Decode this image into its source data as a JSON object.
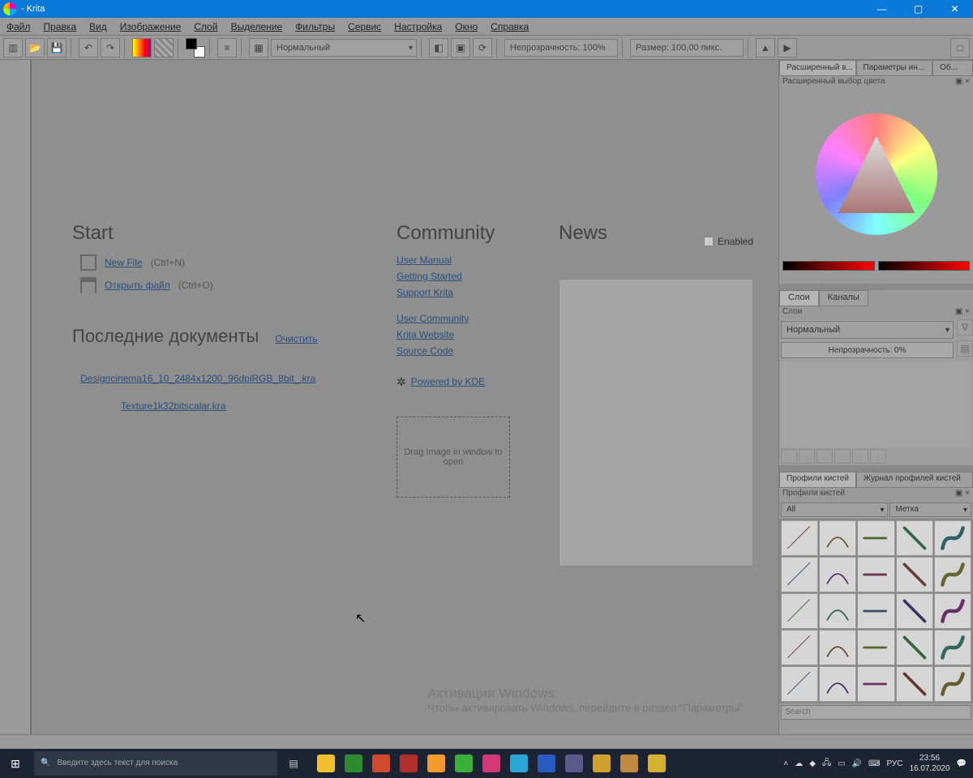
{
  "title": " - Krita",
  "menu": [
    "Файл",
    "Правка",
    "Вид",
    "Изображение",
    "Слой",
    "Выделение",
    "Фильтры",
    "Сервис",
    "Настройка",
    "Окно",
    "Справка"
  ],
  "toolbar": {
    "blendmode": "Нормальный",
    "opacity": "Непрозрачность: 100%",
    "size": "Размер: 100,00 пикс."
  },
  "welcome": {
    "start": "Start",
    "newfile": "New File",
    "newfile_short": "(Ctrl+N)",
    "openfile": "Открыть файл",
    "openfile_short": "(Ctrl+O)",
    "recent_hdr": "Последние документы",
    "clear": "Очистить",
    "recents": [
      "Designcinema16_10_2484x1200_96dpiRGB_8bit_.kra",
      "Texture1k32bitscalar.kra"
    ],
    "community": "Community",
    "links": [
      "User Manual",
      "Getting Started",
      "Support Krita",
      "User Community",
      "Krita Website",
      "Source Code"
    ],
    "powered": "Powered by KDE",
    "drop": "Drag Image in window to open",
    "news": "News",
    "enabled": "Enabled"
  },
  "watermark": {
    "t1": "Активация Windows",
    "t2": "Чтобы активировать Windows, перейдите в раздел \"Параметры\"."
  },
  "right": {
    "tabs1": [
      "Расширенный в...",
      "Параметры ин...",
      "Об..."
    ],
    "color_title": "Расширенный выбор цвета",
    "layer_tabs": [
      "Слои",
      "Каналы"
    ],
    "layers_title": "Слои",
    "layer_blend": "Нормальный",
    "layer_opacity": "Непрозрачность:  0%",
    "brush_tabs": [
      "Профили кистей",
      "Журнал профилей кистей"
    ],
    "brush_title": "Профили кистей",
    "brush_filter_all": "All",
    "brush_filter_tag": "Метка",
    "search": "Search"
  },
  "taskbar": {
    "searchph": "Введите здесь текст для поиска",
    "lang": "РУС",
    "time": "23:56",
    "date": "16.07.2020",
    "colors": [
      "#f0c030",
      "#2e8b2e",
      "#d24a2e",
      "#b03030",
      "#f29a2e",
      "#3ab03a",
      "#d13a76",
      "#2aa6d6",
      "#2a5cc0",
      "#5a5a8a",
      "#d0a030",
      "#c28a40",
      "#d6b030"
    ]
  }
}
